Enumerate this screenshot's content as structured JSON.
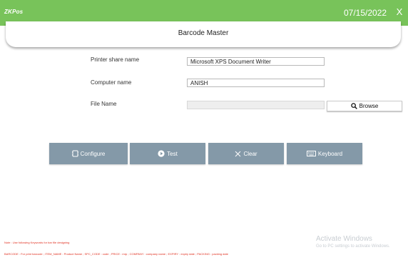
{
  "header": {
    "logo": "ZKPos",
    "date": "07/15/2022",
    "close": "X"
  },
  "page": {
    "title": "Barcode Master"
  },
  "form": {
    "printer_label": "Printer share name",
    "printer_value": "Microsoft XPS Document Writer",
    "computer_label": "Computer name",
    "computer_value": "ANISH",
    "file_label": "File Name",
    "file_value": "",
    "browse_label": "Browse"
  },
  "actions": {
    "configure": "Configure",
    "test": "Test",
    "clear": "Clear",
    "keyboard": "Keyboard"
  },
  "footer": {
    "note": "Note : Use following Keywords for bar file designing",
    "keywords": "BARCODE : For print barcode  ; ITEM_NAME : Product Name ; SPC_CODE : code ; PRICE : mrp ; COMPANY : company name ; EXPIRY : expiry date ; PACKING : packing date"
  },
  "watermark": {
    "title": "Activate Windows",
    "subtitle": "Go to PC settings to activate Windows."
  },
  "colors": {
    "topbar": "#78c35a",
    "action_button": "#8499a8",
    "note_text": "#e03020"
  }
}
